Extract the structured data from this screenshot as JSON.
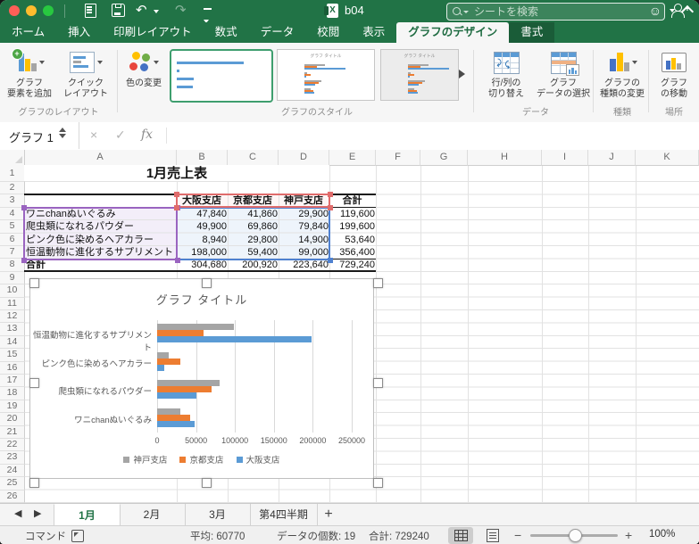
{
  "window": {
    "title": "b04"
  },
  "titlebar": {
    "search_placeholder": "シートを検索"
  },
  "ribbon_tabs": [
    {
      "label": "ホーム"
    },
    {
      "label": "挿入"
    },
    {
      "label": "印刷レイアウト"
    },
    {
      "label": "数式"
    },
    {
      "label": "データ"
    },
    {
      "label": "校閲"
    },
    {
      "label": "表示"
    },
    {
      "label": "グラフのデザイン",
      "active": true
    },
    {
      "label": "書式",
      "dark": true
    }
  ],
  "ribbon": {
    "add_element": [
      "グラフ",
      "要素を追加"
    ],
    "quick_layout": [
      "クイック",
      "レイアウト"
    ],
    "change_colors": "色の変更",
    "layout_group": "グラフのレイアウト",
    "styles_group": "グラフのスタイル",
    "style_thumb_title": "グラフ タイトル",
    "switch_rowcol": [
      "行/列の",
      "切り替え"
    ],
    "select_data": [
      "グラフ",
      "データの選択"
    ],
    "data_group": "データ",
    "change_type": [
      "グラフの",
      "種類の変更"
    ],
    "type_group": "種類",
    "move_chart": [
      "グラフ",
      "の移動"
    ],
    "location_group": "場所"
  },
  "formula_bar": {
    "name_box": "グラフ 1"
  },
  "grid": {
    "columns": [
      "A",
      "B",
      "C",
      "D",
      "E",
      "F",
      "G",
      "H",
      "I",
      "J",
      "K"
    ],
    "row_count": 26
  },
  "sheet": {
    "title": "1月売上表",
    "table": {
      "headers": [
        "大阪支店",
        "京都支店",
        "神戸支店",
        "合計"
      ],
      "rows": [
        {
          "label": "ワニchanぬいぐるみ",
          "values": [
            "47,840",
            "41,860",
            "29,900",
            "119,600"
          ]
        },
        {
          "label": "爬虫類になれるパウダー",
          "values": [
            "49,900",
            "69,860",
            "79,840",
            "199,600"
          ]
        },
        {
          "label": "ピンク色に染めるヘアカラー",
          "values": [
            "8,940",
            "29,800",
            "14,900",
            "53,640"
          ]
        },
        {
          "label": "恒温動物に進化するサプリメント",
          "values": [
            "198,000",
            "59,400",
            "99,000",
            "356,400"
          ]
        }
      ],
      "total_row": {
        "label": "合計",
        "values": [
          "304,680",
          "200,920",
          "223,640",
          "729,240"
        ]
      }
    }
  },
  "chart_data": {
    "type": "bar",
    "orientation": "horizontal",
    "title": "グラフ タイトル",
    "categories": [
      "ワニchanぬいぐるみ",
      "爬虫類になれるパウダー",
      "ピンク色に染めるヘアカラー",
      "恒温動物に進化するサプリメント"
    ],
    "series": [
      {
        "name": "大阪支店",
        "color": "#5B9BD5",
        "values": [
          47840,
          49900,
          8940,
          198000
        ]
      },
      {
        "name": "京都支店",
        "color": "#ED7D31",
        "values": [
          41860,
          69860,
          29800,
          59400
        ]
      },
      {
        "name": "神戸支店",
        "color": "#A5A5A5",
        "values": [
          29900,
          79840,
          14900,
          99000
        ]
      }
    ],
    "xlim": [
      0,
      250000
    ],
    "x_ticks": [
      "0",
      "50000",
      "100000",
      "150000",
      "200000",
      "250000"
    ],
    "legend": [
      "神戸支店",
      "京都支店",
      "大阪支店"
    ],
    "legend_position": "bottom",
    "grid": true
  },
  "sheet_tabs": {
    "tabs": [
      {
        "label": "1月",
        "active": true
      },
      {
        "label": "2月"
      },
      {
        "label": "3月"
      },
      {
        "label": "第4四半期"
      }
    ]
  },
  "status_bar": {
    "mode": "コマンド",
    "average": "平均: 60770",
    "count": "データの個数: 19",
    "sum": "合計: 729240",
    "zoom": "100%"
  },
  "colors": {
    "accent_green": "#217346",
    "series_blue": "#5B9BD5",
    "series_orange": "#ED7D31",
    "series_gray": "#A5A5A5",
    "selection_red": "#E06C6C",
    "selection_purple": "#9A64C0",
    "selection_blue": "#4F81D0"
  }
}
